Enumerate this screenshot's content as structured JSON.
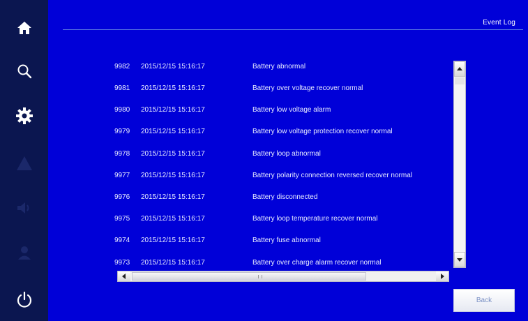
{
  "header": {
    "title": "Event Log"
  },
  "sidebar": {
    "items": [
      {
        "name": "home",
        "icon": "home-icon"
      },
      {
        "name": "search",
        "icon": "search-icon"
      },
      {
        "name": "settings",
        "icon": "gear-icon"
      },
      {
        "name": "alarm",
        "icon": "warning-icon"
      },
      {
        "name": "sound",
        "icon": "speaker-icon"
      },
      {
        "name": "user",
        "icon": "user-icon"
      },
      {
        "name": "power",
        "icon": "power-icon"
      }
    ]
  },
  "events": [
    {
      "id": "9982",
      "time": "2015/12/15 15:16:17",
      "message": "Battery abnormal"
    },
    {
      "id": "9981",
      "time": "2015/12/15 15:16:17",
      "message": "Battery over voltage recover normal"
    },
    {
      "id": "9980",
      "time": "2015/12/15 15:16:17",
      "message": "Battery low voltage alarm"
    },
    {
      "id": "9979",
      "time": "2015/12/15 15:16:17",
      "message": "Battery low voltage protection recover normal"
    },
    {
      "id": "9978",
      "time": "2015/12/15 15:16:17",
      "message": "Battery loop abnormal"
    },
    {
      "id": "9977",
      "time": "2015/12/15 15:16:17",
      "message": "Battery polarity connection reversed recover normal"
    },
    {
      "id": "9976",
      "time": "2015/12/15 15:16:17",
      "message": "Battery disconnected"
    },
    {
      "id": "9975",
      "time": "2015/12/15 15:16:17",
      "message": "Battery loop temperature recover normal"
    },
    {
      "id": "9974",
      "time": "2015/12/15 15:16:17",
      "message": "Battery fuse abnormal"
    },
    {
      "id": "9973",
      "time": "2015/12/15 15:16:17",
      "message": "Battery over charge alarm recover normal"
    }
  ],
  "footer": {
    "back_label": "Back"
  },
  "colors": {
    "background": "#0000d8",
    "sidebar": "#0b1650",
    "text": "#e8ecff"
  }
}
